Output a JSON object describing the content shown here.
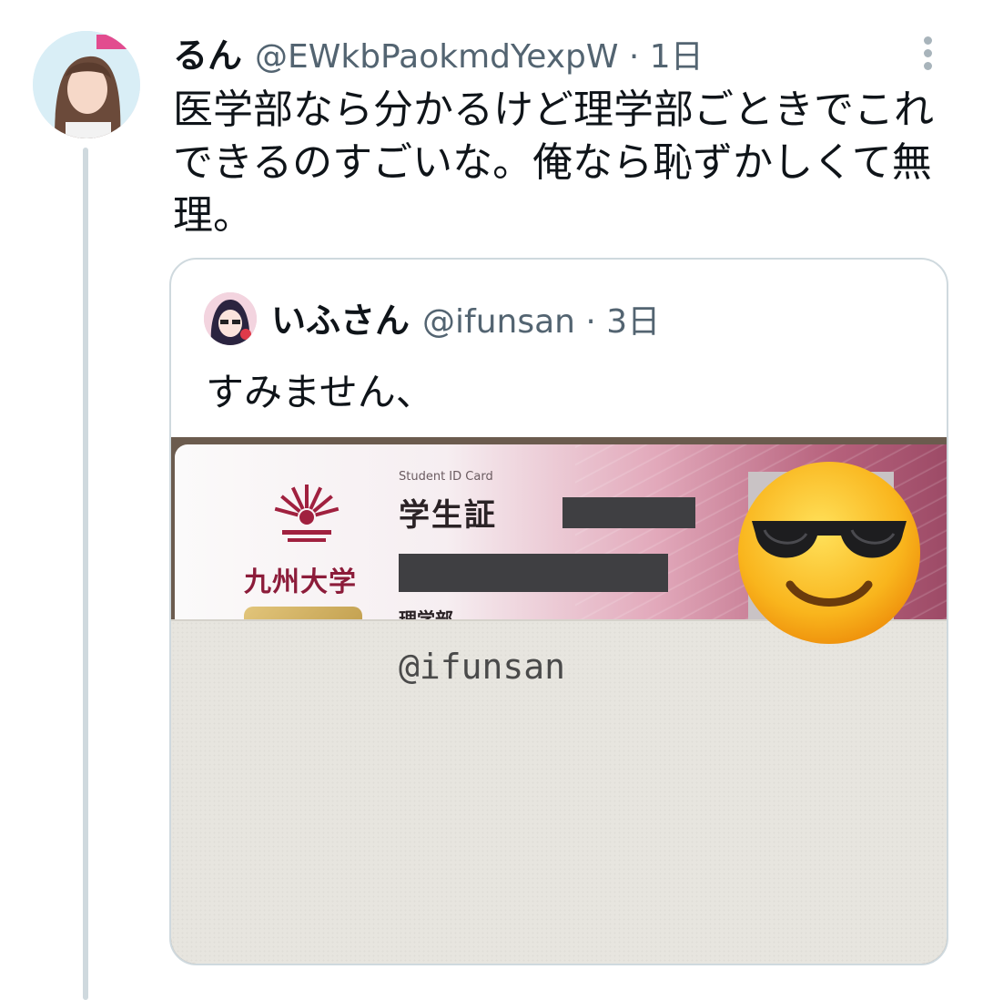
{
  "tweet": {
    "author_name": "るん",
    "meta": "@EWkbPaokmdYexpW · 1日",
    "text_lines": [
      "医学部なら分かるけど理学部ごときでこれ",
      "できるのすごいな。俺なら恥ずかしくて無",
      "理。"
    ],
    "more_icon": "more-vertical-icon"
  },
  "quoted_tweet": {
    "author_name": "いふさん",
    "meta": "@ifunsan · 3日",
    "text": "すみません、",
    "image": {
      "card_subtitle": "Student ID Card",
      "card_title": "学生証",
      "university": "九州大学",
      "department": "理学部",
      "handwritten": "@ifunsan",
      "emoji": "smiling-face-with-sunglasses"
    }
  },
  "colors": {
    "text_primary": "#0f1419",
    "text_secondary": "#536471",
    "border": "#cfd9de"
  }
}
